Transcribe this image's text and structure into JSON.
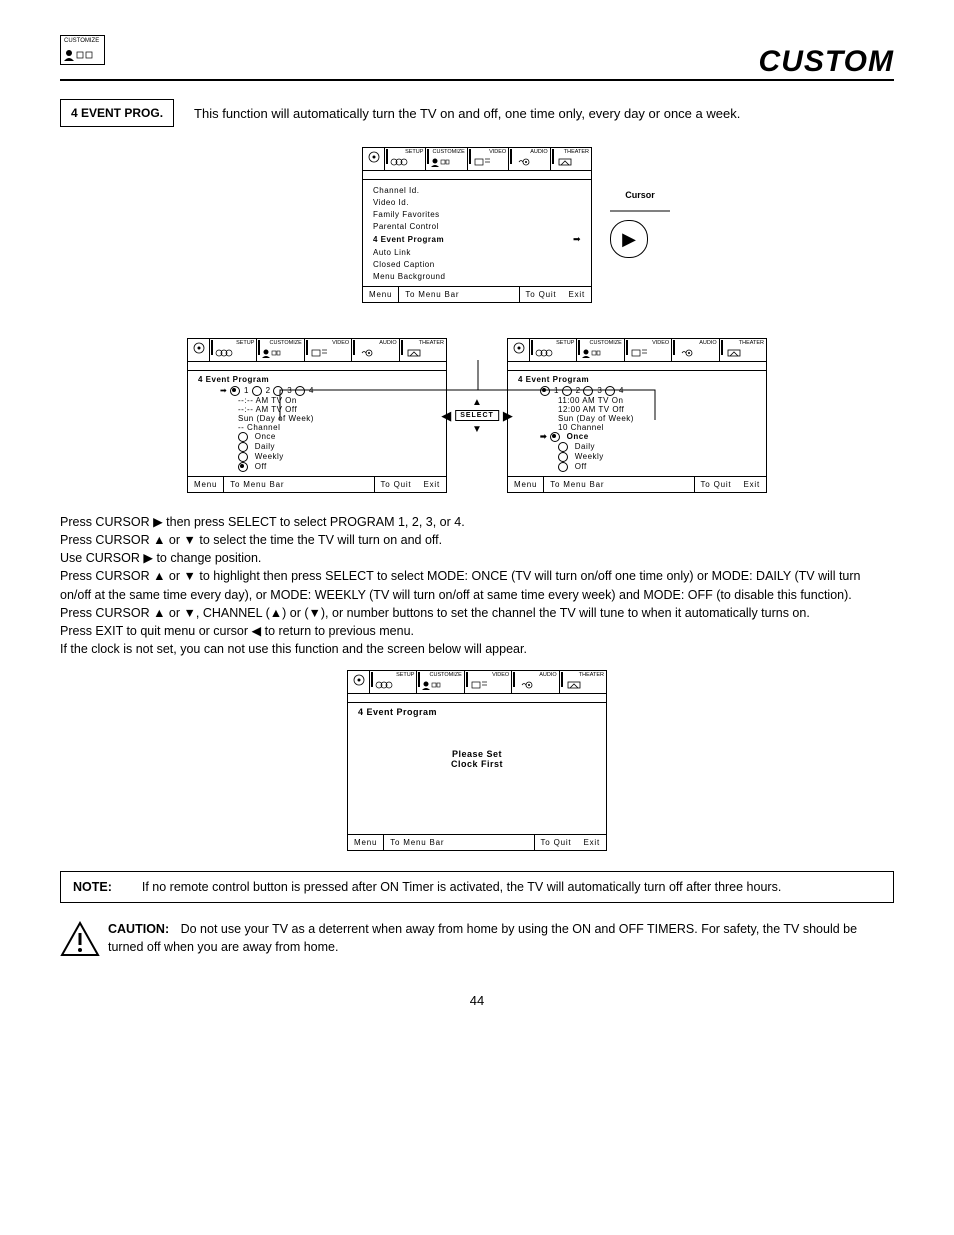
{
  "topIconLabel": "CUSTOMIZE",
  "header": "CUSTOM",
  "sectionLabel": "4 EVENT PROG.",
  "sectionDesc": "This function will automatically turn the TV on and off, one time only, every day or once a week.",
  "tabs": [
    "SETUP",
    "CUSTOMIZE",
    "VIDEO",
    "AUDIO",
    "THEATER"
  ],
  "customizeMenu": {
    "items": [
      "Channel Id.",
      "Video Id.",
      "Family Favorites",
      "Parental Control",
      "4 Event Program",
      "Auto Link",
      "Closed Caption",
      "Menu Background"
    ],
    "selectedIndex": 4
  },
  "cursorLabel": "Cursor",
  "leftPanel": {
    "title": "4 Event Program",
    "numline": "1   2   3   4",
    "l1": "--:-- AM TV On",
    "l2": "--:-- AM TV Off",
    "l3": "Sun (Day of Week)",
    "l4": "-- Channel",
    "opts": [
      "Once",
      "Daily",
      "Weekly",
      "Off"
    ],
    "optSelected": 3,
    "arrowAt": 0
  },
  "rightPanel": {
    "title": "4 Event Program",
    "numline": "1   2   3   4",
    "l1": "11:00 AM TV On",
    "l2": "12:00 AM TV Off",
    "l3": "Sun  (Day of Week)",
    "l4": "10 Channel",
    "opts": [
      "Once",
      "Daily",
      "Weekly",
      "Off"
    ],
    "optSelected": 0,
    "arrowAt": 4
  },
  "selectLabel": "SELECT",
  "footer": {
    "a": "Menu",
    "b": "To Menu Bar",
    "c": "To Quit",
    "d": "Exit"
  },
  "clockPanel": {
    "title": "4 Event Program",
    "msg1": "Please Set",
    "msg2": "Clock First"
  },
  "instr": {
    "l1a": "Press CURSOR ",
    "l1b": " then press SELECT to select PROGRAM 1, 2, 3, or 4.",
    "l2a": "Press CURSOR ",
    "l2b": " or ",
    "l2c": " to select the time the TV will turn on and off.",
    "l3a": "Use CURSOR ",
    "l3b": " to change position.",
    "l4a": "Press CURSOR ",
    "l4b": " or ",
    "l4c": " to highlight then press SELECT to select MODE: ONCE (TV will turn on/off one time only) or MODE: DAILY (TV will turn on/off at the same time every day), or MODE: WEEKLY (TV will turn on/off at same time every week) and MODE: OFF (to disable this function).",
    "l5a": "Press CURSOR ",
    "l5b": " or ",
    "l5c": ", CHANNEL (",
    "l5d": ") or (",
    "l5e": "), or number buttons to set the channel the TV will tune to when it automatically turns on.",
    "l6a": "Press EXIT to quit menu or cursor ",
    "l6b": " to return to previous menu.",
    "l7": "If the clock is not set, you can not use this function and the screen below will appear."
  },
  "note": {
    "label": "NOTE:",
    "text": "If no remote control button is pressed after ON Timer is activated, the TV will automatically turn off after three hours."
  },
  "caution": {
    "label": "CAUTION:",
    "text": "Do not use your TV as a deterrent when away from home by using the ON and OFF TIMERS.  For safety, the TV should be turned off when you are away from home."
  },
  "pageNum": "44"
}
